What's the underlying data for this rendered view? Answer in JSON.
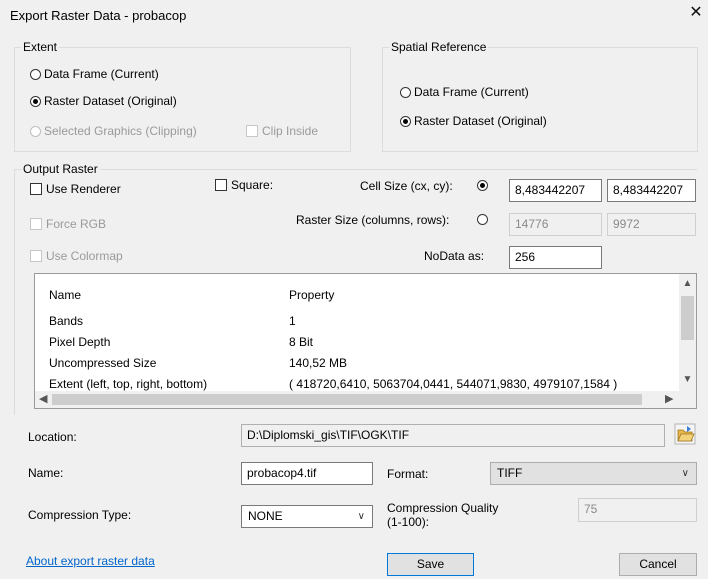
{
  "window": {
    "title": "Export Raster Data - probacop",
    "close_glyph": "✕"
  },
  "extent": {
    "legend": "Extent",
    "data_frame": "Data Frame (Current)",
    "raster_dataset": "Raster Dataset (Original)",
    "selected_graphics": "Selected Graphics (Clipping)",
    "clip_inside": "Clip Inside",
    "selected": "raster_dataset"
  },
  "spatial_reference": {
    "legend": "Spatial Reference",
    "data_frame": "Data Frame (Current)",
    "raster_dataset": "Raster Dataset (Original)",
    "selected": "raster_dataset"
  },
  "output_raster": {
    "legend": "Output Raster",
    "use_renderer": "Use Renderer",
    "force_rgb": "Force RGB",
    "use_colormap": "Use Colormap",
    "square": "Square:",
    "cell_size_label": "Cell Size (cx, cy):",
    "cell_size_x": "8,483442207",
    "cell_size_y": "8,483442207",
    "raster_size_label": "Raster Size (columns, rows):",
    "columns": "14776",
    "rows": "9972",
    "nodata_label": "NoData as:",
    "nodata_value": "256",
    "size_mode": "cell_size"
  },
  "properties": {
    "header": [
      "Name",
      "Property"
    ],
    "rows": [
      [
        "Bands",
        "1"
      ],
      [
        "Pixel Depth",
        "8 Bit"
      ],
      [
        "Uncompressed Size",
        "140,52 MB"
      ],
      [
        "Extent (left, top, right, bottom)",
        "( 418720,6410, 5063704,0441, 544071,9830, 4979107,1584 )"
      ]
    ]
  },
  "location": {
    "label": "Location:",
    "value": "D:\\Diplomski_gis\\TIF\\OGK\\TIF"
  },
  "name": {
    "label": "Name:",
    "value": "probacop4.tif"
  },
  "format": {
    "label": "Format:",
    "value": "TIFF"
  },
  "compression": {
    "type_label": "Compression Type:",
    "type_value": "NONE",
    "quality_label_1": "Compression Quality",
    "quality_label_2": "(1-100):",
    "quality_value": "75"
  },
  "footer": {
    "about_link": "About export raster data",
    "save": "Save",
    "cancel": "Cancel"
  },
  "colors": {
    "background": "#f0f0f0",
    "link": "#0066cc",
    "focus_border": "#0078d7",
    "disabled_text": "#9a9a9a"
  }
}
